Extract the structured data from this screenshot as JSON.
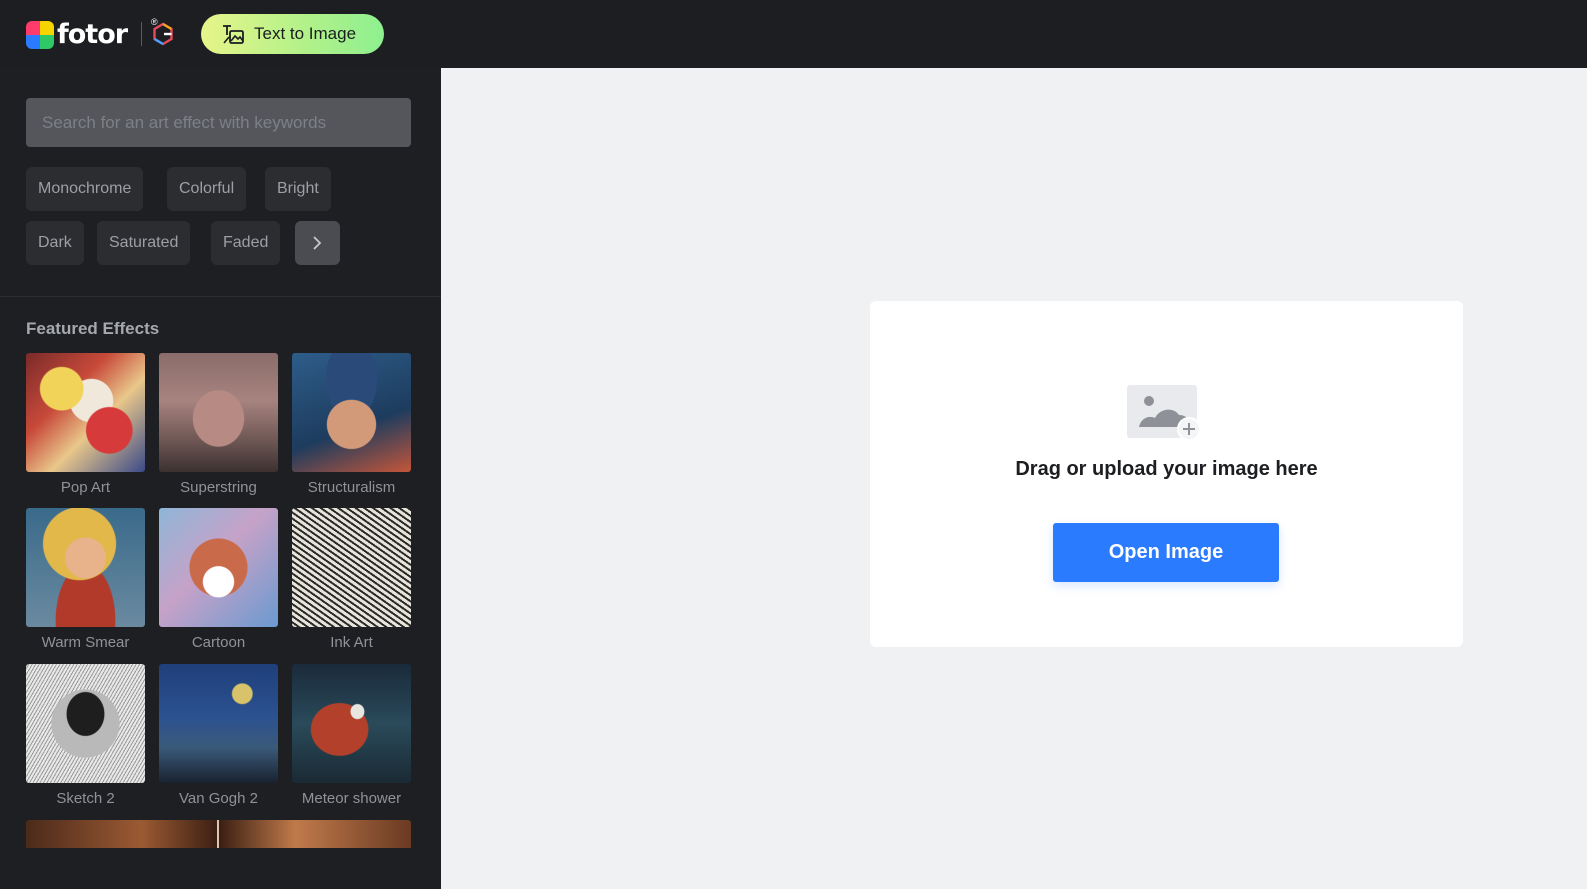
{
  "header": {
    "logo_text": "fotor",
    "logo_reg": "®",
    "text_to_image_label": "Text to Image"
  },
  "sidebar": {
    "search_placeholder": "Search for an art effect with keywords",
    "chips": [
      "Monochrome",
      "Colorful",
      "Bright",
      "Dark",
      "Saturated",
      "Faded"
    ],
    "featured_title": "Featured Effects",
    "effects": [
      {
        "label": "Pop Art"
      },
      {
        "label": "Superstring"
      },
      {
        "label": "Structuralism"
      },
      {
        "label": "Warm Smear"
      },
      {
        "label": "Cartoon"
      },
      {
        "label": "Ink Art"
      },
      {
        "label": "Sketch 2"
      },
      {
        "label": "Van Gogh 2"
      },
      {
        "label": "Meteor shower"
      }
    ]
  },
  "main": {
    "upload_text": "Drag or upload your image here",
    "open_button_label": "Open Image"
  },
  "colors": {
    "topbar_bg": "#1d1e21",
    "sidebar_bg": "#1e1f22",
    "main_bg": "#f0f1f3",
    "primary_button": "#2b7bff",
    "text_to_image_gradient_start": "#e6f58a",
    "text_to_image_gradient_end": "#8ef08f"
  },
  "icons": [
    "fotor-logo-icon",
    "g-brand-icon",
    "text-to-image-icon",
    "chevron-right-icon",
    "image-upload-icon"
  ]
}
